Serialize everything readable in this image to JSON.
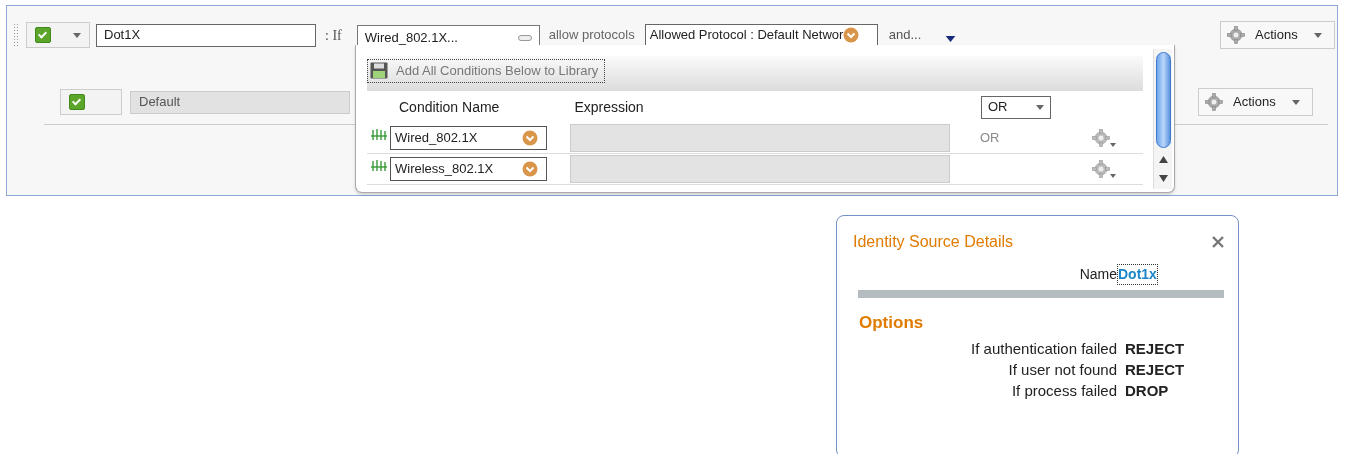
{
  "rule": {
    "enabled": true,
    "name": "Dot1X",
    "if_label": ": If",
    "condition": "Wired_802.1X...",
    "allow_label": "allow protocols",
    "protocol": "Allowed Protocol : Default Networ",
    "and_label": "and...",
    "actions": "Actions"
  },
  "default_rule": {
    "enabled": true,
    "name": "Default",
    "actions": "Actions"
  },
  "conditions_popup": {
    "add_button": "Add All Conditions Below to Library",
    "columns": [
      "Condition Name",
      "Expression"
    ],
    "operator": "OR",
    "rows": [
      {
        "name": "Wired_802.1X",
        "operator": "OR"
      },
      {
        "name": "Wireless_802.1X"
      }
    ]
  },
  "identity_dialog": {
    "title": "Identity Source Details",
    "name_label": "Name",
    "name_value": "Dot1x",
    "section": "Options",
    "options": [
      {
        "label": "If authentication failed",
        "value": "REJECT"
      },
      {
        "label": "If user not found",
        "value": "REJECT"
      },
      {
        "label": "If process failed",
        "value": "DROP"
      }
    ]
  }
}
